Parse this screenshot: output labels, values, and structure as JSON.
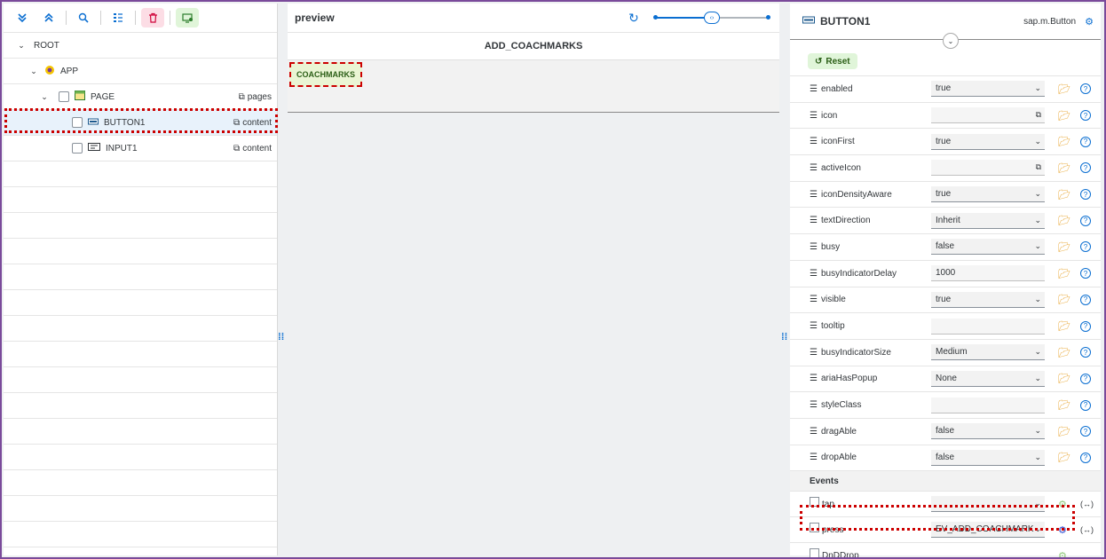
{
  "tree": {
    "rows": [
      {
        "label": "ROOT",
        "aggregation": ""
      },
      {
        "label": "APP",
        "aggregation": ""
      },
      {
        "label": "PAGE",
        "aggregation": "pages"
      },
      {
        "label": "BUTTON1",
        "aggregation": "content"
      },
      {
        "label": "INPUT1",
        "aggregation": "content"
      }
    ]
  },
  "preview": {
    "title": "preview",
    "page_title": "ADD_COACHMARKS",
    "button_label": "COACHMARKS"
  },
  "properties": {
    "title": "BUTTON1",
    "class_name": "sap.m.Button",
    "reset_label": "Reset",
    "items": [
      {
        "name": "enabled",
        "value": "true",
        "kind": "select"
      },
      {
        "name": "icon",
        "value": "",
        "kind": "input-icon"
      },
      {
        "name": "iconFirst",
        "value": "true",
        "kind": "select"
      },
      {
        "name": "activeIcon",
        "value": "",
        "kind": "input-icon"
      },
      {
        "name": "iconDensityAware",
        "value": "true",
        "kind": "select"
      },
      {
        "name": "textDirection",
        "value": "Inherit",
        "kind": "select"
      },
      {
        "name": "busy",
        "value": "false",
        "kind": "select"
      },
      {
        "name": "busyIndicatorDelay",
        "value": "1000",
        "kind": "input"
      },
      {
        "name": "visible",
        "value": "true",
        "kind": "select"
      },
      {
        "name": "tooltip",
        "value": "",
        "kind": "input"
      },
      {
        "name": "busyIndicatorSize",
        "value": "Medium",
        "kind": "select"
      },
      {
        "name": "ariaHasPopup",
        "value": "None",
        "kind": "select"
      },
      {
        "name": "styleClass",
        "value": "",
        "kind": "input"
      },
      {
        "name": "dragAble",
        "value": "false",
        "kind": "select"
      },
      {
        "name": "dropAble",
        "value": "false",
        "kind": "select"
      }
    ],
    "events_label": "Events",
    "events": [
      {
        "name": "tap",
        "value": ""
      },
      {
        "name": "press",
        "value": "EV_ADD_COACHMARK"
      },
      {
        "name": "DnDDrop",
        "value": ""
      }
    ]
  }
}
